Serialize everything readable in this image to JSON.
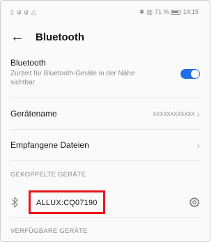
{
  "statusbar": {
    "left_icons": [
      "file-icon",
      "usb-icon",
      "usb-icon",
      "warning-icon"
    ],
    "right_text": "71 %",
    "time": "14:15"
  },
  "header": {
    "back_icon": "arrow-left-icon",
    "title": "Bluetooth"
  },
  "bluetooth": {
    "label": "Bluetooth",
    "sublabel": "Zurzeit für Bluetooth-Geräte in der Nähe sichtbar",
    "enabled": true,
    "toggle_color": "#1f6fe5"
  },
  "device_name": {
    "label": "Gerätename",
    "value": "xxxxxxxxxxxx"
  },
  "received_files": {
    "label": "Empfangene Dateien"
  },
  "paired_group": {
    "title": "GEKOPPELTE GERÄTE",
    "devices": [
      {
        "name": "ALLUX:CQ07190",
        "highlight_color": "#e8141b"
      }
    ]
  },
  "available_group": {
    "title": "VERFÜGBARE GERÄTE"
  }
}
